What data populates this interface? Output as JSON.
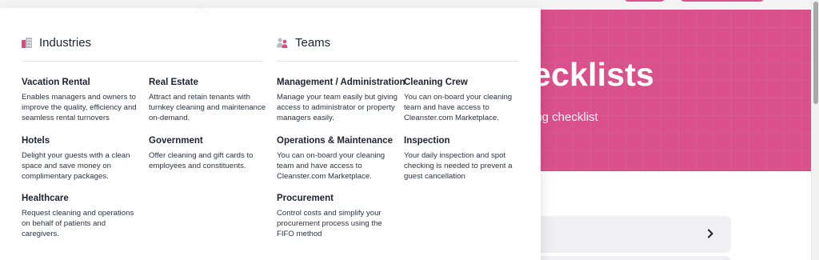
{
  "hero": {
    "title_fragment": "ecklists",
    "subtitle_fragment": "ing checklist"
  },
  "industries": {
    "title": "Industries",
    "icon": "building-icon",
    "items": [
      {
        "title": "Vacation Rental",
        "description": "Enables managers and owners to improve the quality, efficiency and seamless rental turnovers"
      },
      {
        "title": "Real Estate",
        "description": "Attract and retain tenants with turnkey cleaning and maintenance on-demand."
      },
      {
        "title": "Hotels",
        "description": "Delight your guests with a clean space and save money on complimentary packages."
      },
      {
        "title": "Government",
        "description": "Offer cleaning and gift cards to employees and constituents."
      },
      {
        "title": "Healthcare",
        "description": "Request cleaning and operations on behalf of patients and caregivers."
      }
    ]
  },
  "teams": {
    "title": "Teams",
    "icon": "people-icon",
    "items": [
      {
        "title": "Management / Administration",
        "description": "Manage your team easily but giving access to administrator or property managers easily."
      },
      {
        "title": "Cleaning Crew",
        "description": "You can on-board your cleaning team and have access to Cleanster.com Marketplace."
      },
      {
        "title": "Operations & Maintenance",
        "description": "You can on-board your cleaning team and have access to Cleanster.com Marketplace."
      },
      {
        "title": "Inspection",
        "description": "Your daily inspection and spot checking is needed to prevent a guest cancellation"
      },
      {
        "title": "Procurement",
        "description": "Control costs and simplify your procurement process using the FIFO method"
      }
    ]
  },
  "colors": {
    "accent": "#d9508b",
    "icon_pink": "#e0497f",
    "icon_gray": "#b9bcc4",
    "text": "#1f2330"
  }
}
